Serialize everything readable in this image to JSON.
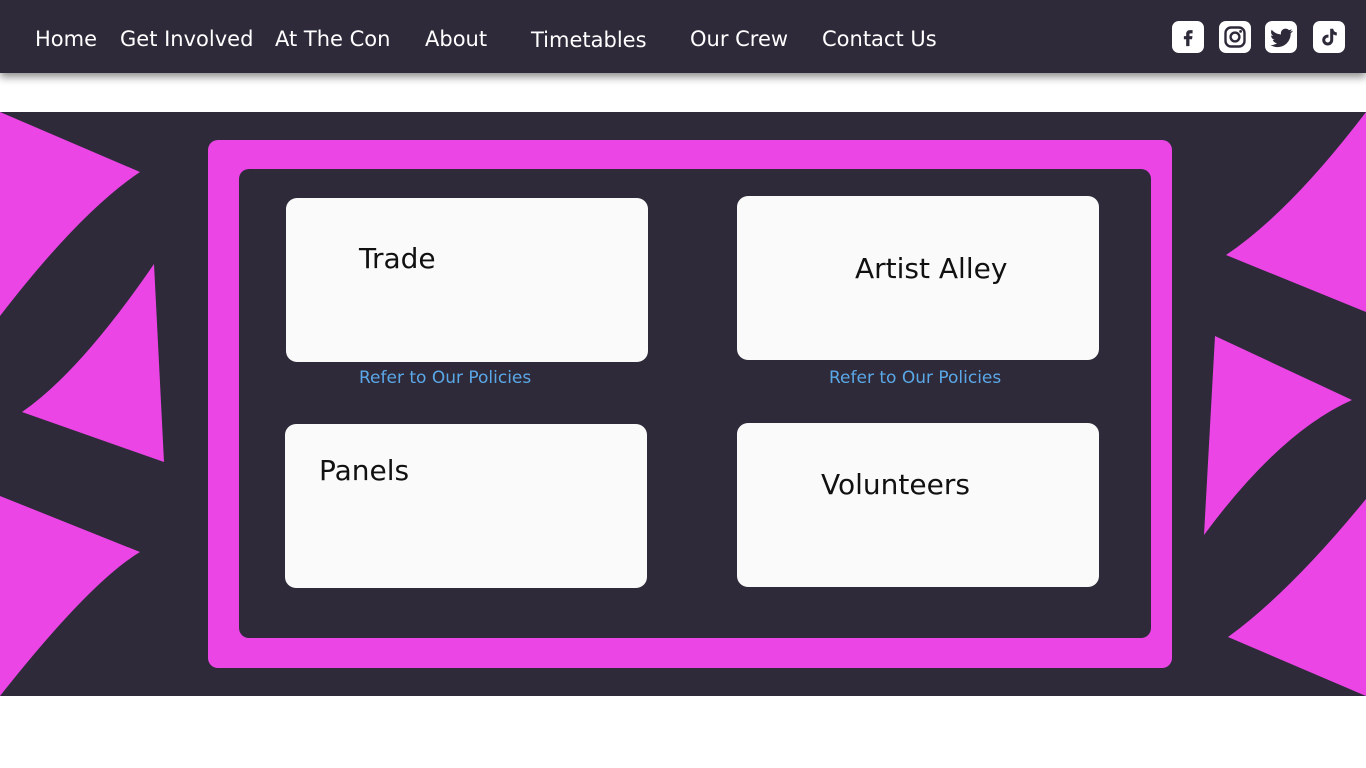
{
  "nav": {
    "items": [
      {
        "label": "Home"
      },
      {
        "label": "Get Involved"
      },
      {
        "label": "At The Con"
      },
      {
        "label": "About"
      },
      {
        "label": "Timetables"
      },
      {
        "label": "Our Crew"
      },
      {
        "label": "Contact Us"
      }
    ],
    "social": [
      "facebook-icon",
      "instagram-icon",
      "twitter-icon",
      "tiktok-icon"
    ]
  },
  "cards": [
    {
      "title": "Trade",
      "link": "Refer to Our Policies"
    },
    {
      "title": "Artist Alley",
      "link": "Refer to Our Policies"
    },
    {
      "title": "Panels"
    },
    {
      "title": "Volunteers"
    }
  ],
  "colors": {
    "background_dark": "#2e2a3a",
    "accent_pink": "#ec45e6",
    "card_white": "#fafafa",
    "link_blue": "#5aa8e8"
  }
}
